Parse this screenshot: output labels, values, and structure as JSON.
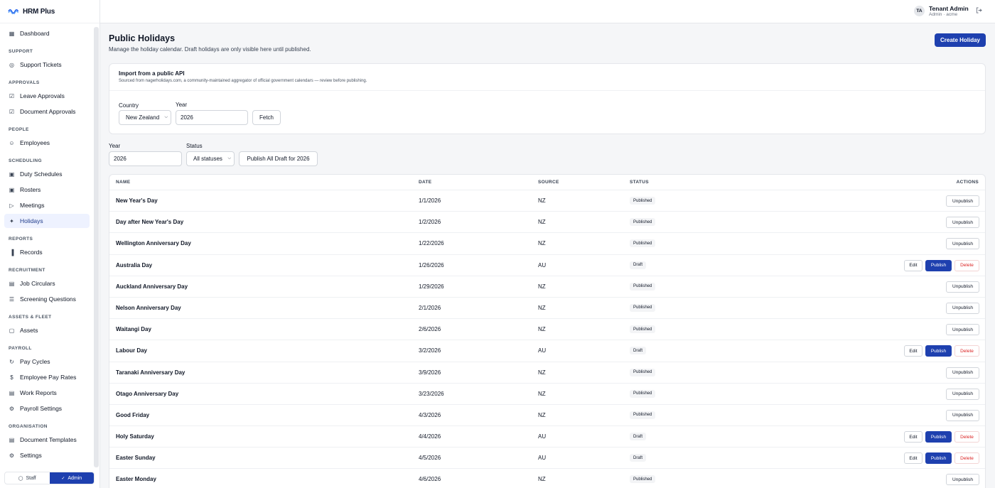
{
  "app": {
    "name": "HRM Plus"
  },
  "user": {
    "initials": "TA",
    "name": "Tenant Admin",
    "sub": "Admin · acme"
  },
  "sidebar": {
    "groups": [
      {
        "title": "",
        "items": [
          {
            "label": "Dashboard",
            "icon": "grid-icon"
          }
        ]
      },
      {
        "title": "SUPPORT",
        "items": [
          {
            "label": "Support Tickets",
            "icon": "lifebuoy-icon"
          }
        ]
      },
      {
        "title": "APPROVALS",
        "items": [
          {
            "label": "Leave Approvals",
            "icon": "clipboard-check-icon"
          },
          {
            "label": "Document Approvals",
            "icon": "file-check-icon"
          }
        ]
      },
      {
        "title": "PEOPLE",
        "items": [
          {
            "label": "Employees",
            "icon": "users-icon"
          }
        ]
      },
      {
        "title": "SCHEDULING",
        "items": [
          {
            "label": "Duty Schedules",
            "icon": "calendar-icon"
          },
          {
            "label": "Rosters",
            "icon": "calendar-icon"
          },
          {
            "label": "Meetings",
            "icon": "video-icon"
          },
          {
            "label": "Holidays",
            "icon": "party-icon",
            "active": true
          }
        ]
      },
      {
        "title": "REPORTS",
        "items": [
          {
            "label": "Records",
            "icon": "bar-chart-icon"
          }
        ]
      },
      {
        "title": "RECRUITMENT",
        "items": [
          {
            "label": "Job Circulars",
            "icon": "clipboard-icon"
          },
          {
            "label": "Screening Questions",
            "icon": "list-check-icon"
          }
        ]
      },
      {
        "title": "ASSETS & FLEET",
        "items": [
          {
            "label": "Assets",
            "icon": "box-icon"
          }
        ]
      },
      {
        "title": "PAYROLL",
        "items": [
          {
            "label": "Pay Cycles",
            "icon": "refresh-icon"
          },
          {
            "label": "Employee Pay Rates",
            "icon": "dollar-icon"
          },
          {
            "label": "Work Reports",
            "icon": "file-icon"
          },
          {
            "label": "Payroll Settings",
            "icon": "gear-icon"
          }
        ]
      },
      {
        "title": "ORGANISATION",
        "items": [
          {
            "label": "Document Templates",
            "icon": "file-icon"
          },
          {
            "label": "Settings",
            "icon": "gear-icon"
          }
        ]
      }
    ],
    "mode": {
      "staff": "Staff",
      "admin": "Admin",
      "active": "admin"
    }
  },
  "page": {
    "title": "Public Holidays",
    "subtitle": "Manage the holiday calendar. Draft holidays are only visible here until published.",
    "create_label": "Create Holiday"
  },
  "import": {
    "title": "Import from a public API",
    "subtitle": "Sourced from nagerholidays.com, a community-maintained aggregator of official government calendars — review before publishing.",
    "country_label": "Country",
    "country_value": "New Zealand",
    "year_label": "Year",
    "year_value": "2026",
    "fetch_label": "Fetch"
  },
  "filters": {
    "year_label": "Year",
    "year_value": "2026",
    "status_label": "Status",
    "status_value": "All statuses",
    "publish_all_label": "Publish All Draft for 2026"
  },
  "table": {
    "columns": {
      "name": "NAME",
      "date": "DATE",
      "source": "SOURCE",
      "status": "STATUS",
      "actions": "ACTIONS"
    },
    "action_labels": {
      "unpublish": "Unpublish",
      "edit": "Edit",
      "publish": "Publish",
      "delete": "Delete"
    },
    "rows": [
      {
        "name": "New Year's Day",
        "date": "1/1/2026",
        "source": "NZ",
        "status": "Published"
      },
      {
        "name": "Day after New Year's Day",
        "date": "1/2/2026",
        "source": "NZ",
        "status": "Published"
      },
      {
        "name": "Wellington Anniversary Day",
        "date": "1/22/2026",
        "source": "NZ",
        "status": "Published"
      },
      {
        "name": "Australia Day",
        "date": "1/26/2026",
        "source": "AU",
        "status": "Draft"
      },
      {
        "name": "Auckland Anniversary Day",
        "date": "1/29/2026",
        "source": "NZ",
        "status": "Published"
      },
      {
        "name": "Nelson Anniversary Day",
        "date": "2/1/2026",
        "source": "NZ",
        "status": "Published"
      },
      {
        "name": "Waitangi Day",
        "date": "2/6/2026",
        "source": "NZ",
        "status": "Published"
      },
      {
        "name": "Labour Day",
        "date": "3/2/2026",
        "source": "AU",
        "status": "Draft"
      },
      {
        "name": "Taranaki Anniversary Day",
        "date": "3/9/2026",
        "source": "NZ",
        "status": "Published"
      },
      {
        "name": "Otago Anniversary Day",
        "date": "3/23/2026",
        "source": "NZ",
        "status": "Published"
      },
      {
        "name": "Good Friday",
        "date": "4/3/2026",
        "source": "NZ",
        "status": "Published"
      },
      {
        "name": "Holy Saturday",
        "date": "4/4/2026",
        "source": "AU",
        "status": "Draft"
      },
      {
        "name": "Easter Sunday",
        "date": "4/5/2026",
        "source": "AU",
        "status": "Draft"
      },
      {
        "name": "Easter Monday",
        "date": "4/6/2026",
        "source": "NZ",
        "status": "Published"
      }
    ]
  }
}
